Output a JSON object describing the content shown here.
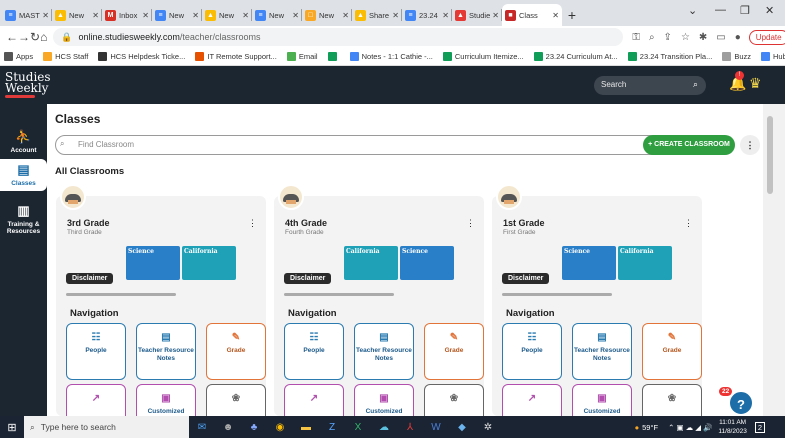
{
  "browser": {
    "tabs": [
      {
        "label": "MAST",
        "color": "#4285f4",
        "glyph": "≡"
      },
      {
        "label": "New",
        "color": "#fbbc04",
        "glyph": "▲"
      },
      {
        "label": "Inbox",
        "color": "#d93025",
        "glyph": "M"
      },
      {
        "label": "New",
        "color": "#4285f4",
        "glyph": "≡"
      },
      {
        "label": "New",
        "color": "#fbbc04",
        "glyph": "▲"
      },
      {
        "label": "New",
        "color": "#4285f4",
        "glyph": "≡"
      },
      {
        "label": "New",
        "color": "#f9a825",
        "glyph": "□"
      },
      {
        "label": "Share",
        "color": "#fbbc04",
        "glyph": "▲"
      },
      {
        "label": "23.24",
        "color": "#4285f4",
        "glyph": "≡"
      },
      {
        "label": "Studie",
        "color": "#e53935",
        "glyph": "▲"
      },
      {
        "label": "Class",
        "color": "#c62828",
        "glyph": "■"
      }
    ],
    "url_host": "online.studiesweekly.com",
    "url_path": "/teacher/classrooms",
    "update_label": "Update",
    "bookmarks": [
      {
        "label": "Apps",
        "color": "#555"
      },
      {
        "label": "HCS Staff",
        "color": "#f9a825"
      },
      {
        "label": "HCS Helpdesk Ticke...",
        "color": "#333"
      },
      {
        "label": "IT Remote Support...",
        "color": "#e65100"
      },
      {
        "label": "Email",
        "color": "#4caf50"
      },
      {
        "label": "",
        "color": "#0f9d58"
      },
      {
        "label": "Notes - 1:1 Cathie -...",
        "color": "#4285f4"
      },
      {
        "label": "Curriculum Itemize...",
        "color": "#0f9d58"
      },
      {
        "label": "23.24 Curriculum At...",
        "color": "#0f9d58"
      },
      {
        "label": "23.24 Transition Pla...",
        "color": "#0f9d58"
      },
      {
        "label": "Buzz",
        "color": "#9e9e9e"
      },
      {
        "label": "Hub",
        "color": "#4285f4"
      }
    ]
  },
  "header": {
    "logo_line1": "Studies",
    "logo_line2": "Weekly",
    "search_placeholder": "Search",
    "notif_count": "!"
  },
  "sidebar": {
    "items": [
      {
        "label": "Account",
        "icon": "account-icon"
      },
      {
        "label": "Classes",
        "icon": "classes-icon"
      },
      {
        "label": "Training & Resources",
        "icon": "books-icon"
      }
    ]
  },
  "main": {
    "title": "Classes",
    "find_placeholder": "Find Classroom",
    "create_label": "+ CREATE CLASSROOM",
    "all_title": "All Classrooms",
    "disclaimer": "Disclaimer",
    "navigation": "Navigation",
    "classes": [
      {
        "name": "3rd Grade",
        "sub": "Third Grade",
        "books": [
          "Science",
          "California"
        ]
      },
      {
        "name": "4th Grade",
        "sub": "Fourth Grade",
        "books": [
          "California",
          "Science"
        ]
      },
      {
        "name": "1st Grade",
        "sub": "First Grade",
        "books": [
          "Science",
          "California"
        ]
      }
    ],
    "tiles": [
      {
        "label": "People",
        "color": "#2b7bb0"
      },
      {
        "label": "Teacher Resource Notes",
        "color": "#2b7bb0"
      },
      {
        "label": "Grade",
        "color": "#e2743a"
      },
      {
        "label": "",
        "color": "#b24fae"
      },
      {
        "label": "Customized",
        "color": "#b24fae"
      },
      {
        "label": "",
        "color": "#666"
      }
    ]
  },
  "help": {
    "badge": "22",
    "label": "?"
  },
  "taskbar": {
    "search": "Type here to search",
    "weather": "59°F",
    "time": "11:01 AM",
    "date": "11/8/2023",
    "notif": "2"
  }
}
